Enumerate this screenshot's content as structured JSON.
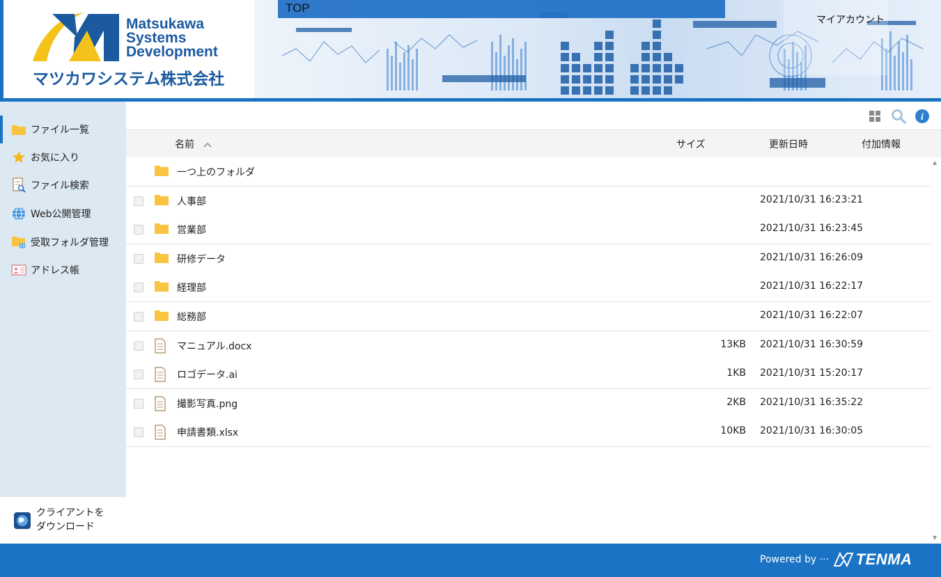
{
  "header": {
    "logo_en_lines": [
      "Matsukawa",
      "Systems",
      "Development"
    ],
    "logo_jp": "マツカワシステム株式会社",
    "top_label": "TOP",
    "account_label": "マイアカウント"
  },
  "sidebar": {
    "items": [
      {
        "label": "ファイル一覧",
        "icon": "folder-icon",
        "active": true
      },
      {
        "label": "お気に入り",
        "icon": "star-icon"
      },
      {
        "label": "ファイル検索",
        "icon": "file-search-icon"
      },
      {
        "label": "Web公開管理",
        "icon": "globe-icon"
      },
      {
        "label": "受取フォルダ管理",
        "icon": "receive-folder-icon"
      },
      {
        "label": "アドレス帳",
        "icon": "address-book-icon"
      }
    ],
    "client_download": {
      "line1": "クライアントを",
      "line2": "ダウンロード"
    }
  },
  "toolbar": {
    "icons": [
      "grid-view-icon",
      "search-icon",
      "info-icon"
    ]
  },
  "columns": {
    "name": "名前",
    "size": "サイズ",
    "modified": "更新日時",
    "extra": "付加情報",
    "sort_indicator": "^"
  },
  "files": [
    {
      "name": "一つ上のフォルダ",
      "type": "folder",
      "size": "",
      "date": "",
      "checkbox": false
    },
    {
      "name": "人事部",
      "type": "folder",
      "size": "",
      "date": "2021/10/31 16:23:21",
      "checkbox": true
    },
    {
      "name": "営業部",
      "type": "folder",
      "size": "",
      "date": "2021/10/31 16:23:45",
      "checkbox": true
    },
    {
      "name": "研修データ",
      "type": "folder",
      "size": "",
      "date": "2021/10/31 16:26:09",
      "checkbox": true
    },
    {
      "name": "経理部",
      "type": "folder",
      "size": "",
      "date": "2021/10/31 16:22:17",
      "checkbox": true
    },
    {
      "name": "総務部",
      "type": "folder",
      "size": "",
      "date": "2021/10/31 16:22:07",
      "checkbox": true
    },
    {
      "name": "マニュアル.docx",
      "type": "file",
      "size": "13KB",
      "date": "2021/10/31 16:30:59",
      "checkbox": true
    },
    {
      "name": "ロゴデータ.ai",
      "type": "file",
      "size": "1KB",
      "date": "2021/10/31 15:20:17",
      "checkbox": true
    },
    {
      "name": "撮影写真.png",
      "type": "file",
      "size": "2KB",
      "date": "2021/10/31 16:35:22",
      "checkbox": true
    },
    {
      "name": "申請書類.xlsx",
      "type": "file",
      "size": "10KB",
      "date": "2021/10/31 16:30:05",
      "checkbox": true
    }
  ],
  "footer": {
    "powered_by": "Powered by ···",
    "brand": "TENMA"
  },
  "colors": {
    "accent": "#1a73c4",
    "logo_blue": "#1c5aa0",
    "logo_yellow": "#f5c21b",
    "folder": "#f9c440",
    "sidebar_bg": "#dce8f2"
  }
}
